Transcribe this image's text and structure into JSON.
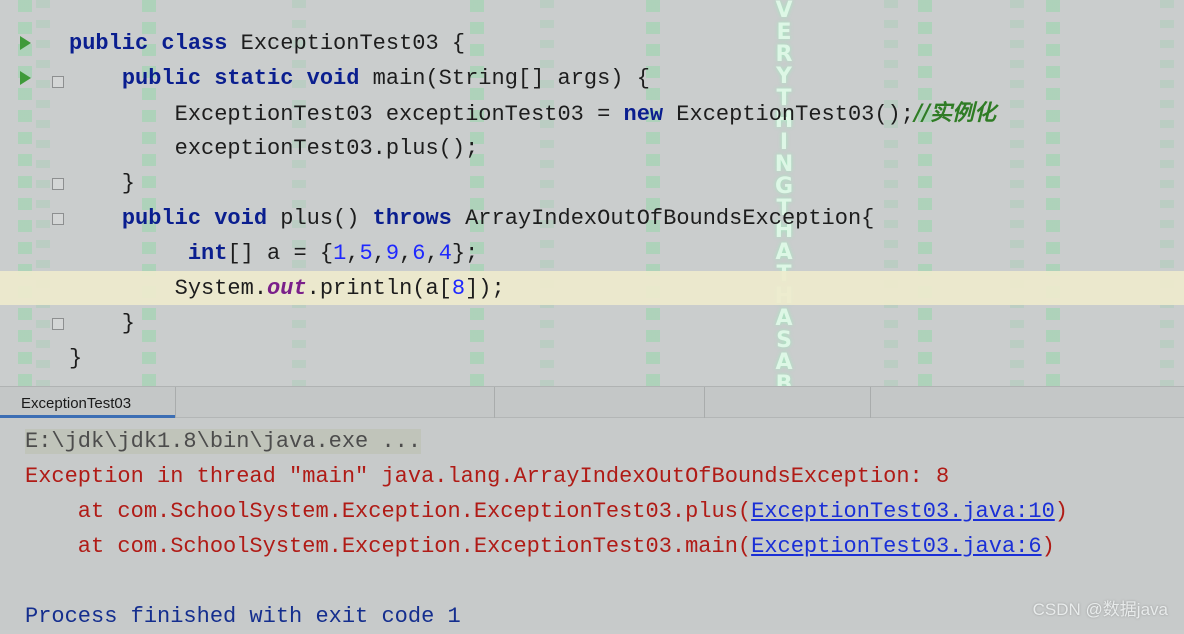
{
  "editor": {
    "lines": [
      [
        {
          "t": "public",
          "c": "kw"
        },
        {
          "t": " "
        },
        {
          "t": "class",
          "c": "kw"
        },
        {
          "t": " ExceptionTest03 {"
        }
      ],
      [
        {
          "t": "    "
        },
        {
          "t": "public",
          "c": "kw"
        },
        {
          "t": " "
        },
        {
          "t": "static",
          "c": "kw"
        },
        {
          "t": " "
        },
        {
          "t": "void",
          "c": "kw"
        },
        {
          "t": " main(String[] args) {"
        }
      ],
      [
        {
          "t": "        ExceptionTest03 exceptionTest03 = "
        },
        {
          "t": "new",
          "c": "kw"
        },
        {
          "t": " ExceptionTest03();"
        },
        {
          "t": "//实例化",
          "c": "comment"
        }
      ],
      [
        {
          "t": "        exceptionTest03.plus();"
        }
      ],
      [
        {
          "t": "    }"
        }
      ],
      [
        {
          "t": "    "
        },
        {
          "t": "public",
          "c": "kw"
        },
        {
          "t": " "
        },
        {
          "t": "void",
          "c": "kw"
        },
        {
          "t": " plus() "
        },
        {
          "t": "throws",
          "c": "kw"
        },
        {
          "t": " ArrayIndexOutOfBoundsException{"
        }
      ],
      [
        {
          "t": "         "
        },
        {
          "t": "int",
          "c": "kw"
        },
        {
          "t": "[] a = {"
        },
        {
          "t": "1",
          "c": "num"
        },
        {
          "t": ","
        },
        {
          "t": "5",
          "c": "num"
        },
        {
          "t": ","
        },
        {
          "t": "9",
          "c": "num"
        },
        {
          "t": ","
        },
        {
          "t": "6",
          "c": "num"
        },
        {
          "t": ","
        },
        {
          "t": "4",
          "c": "num"
        },
        {
          "t": "};"
        }
      ],
      [
        {
          "t": "        System."
        },
        {
          "t": "out",
          "c": "field"
        },
        {
          "t": ".println(a["
        },
        {
          "t": "8",
          "c": "num"
        },
        {
          "t": "]);"
        }
      ],
      [
        {
          "t": "    }"
        }
      ],
      [
        {
          "t": "}"
        }
      ]
    ],
    "background_text": "VERYTHING THAT HAS A BEGIN"
  },
  "tool_window": {
    "tab_label": "ExceptionTest03"
  },
  "console": {
    "lines": [
      [
        {
          "t": "E:\\jdk\\jdk1.8\\bin\\java.exe ...",
          "c": "cmd"
        }
      ],
      [
        {
          "t": "Exception in thread \"main\" java.lang.ArrayIndexOutOfBoundsException: 8",
          "c": "err"
        }
      ],
      [
        {
          "t": "    at com.SchoolSystem.Exception.ExceptionTest03.plus(",
          "c": "err"
        },
        {
          "t": "ExceptionTest03.java:10",
          "c": "link"
        },
        {
          "t": ")",
          "c": "err"
        }
      ],
      [
        {
          "t": "    at com.SchoolSystem.Exception.ExceptionTest03.main(",
          "c": "err"
        },
        {
          "t": "ExceptionTest03.java:6",
          "c": "link"
        },
        {
          "t": ")",
          "c": "err"
        }
      ],
      [
        {
          "t": ""
        }
      ],
      [
        {
          "t": "Process finished with exit code 1",
          "c": "fin"
        }
      ]
    ]
  },
  "watermark": "CSDN @数据java",
  "colors": {
    "keyword": "#0a1e8f",
    "number": "#1e28ff",
    "error": "#b01b16",
    "link": "#1a2fd6",
    "comment": "#2f7c25"
  }
}
